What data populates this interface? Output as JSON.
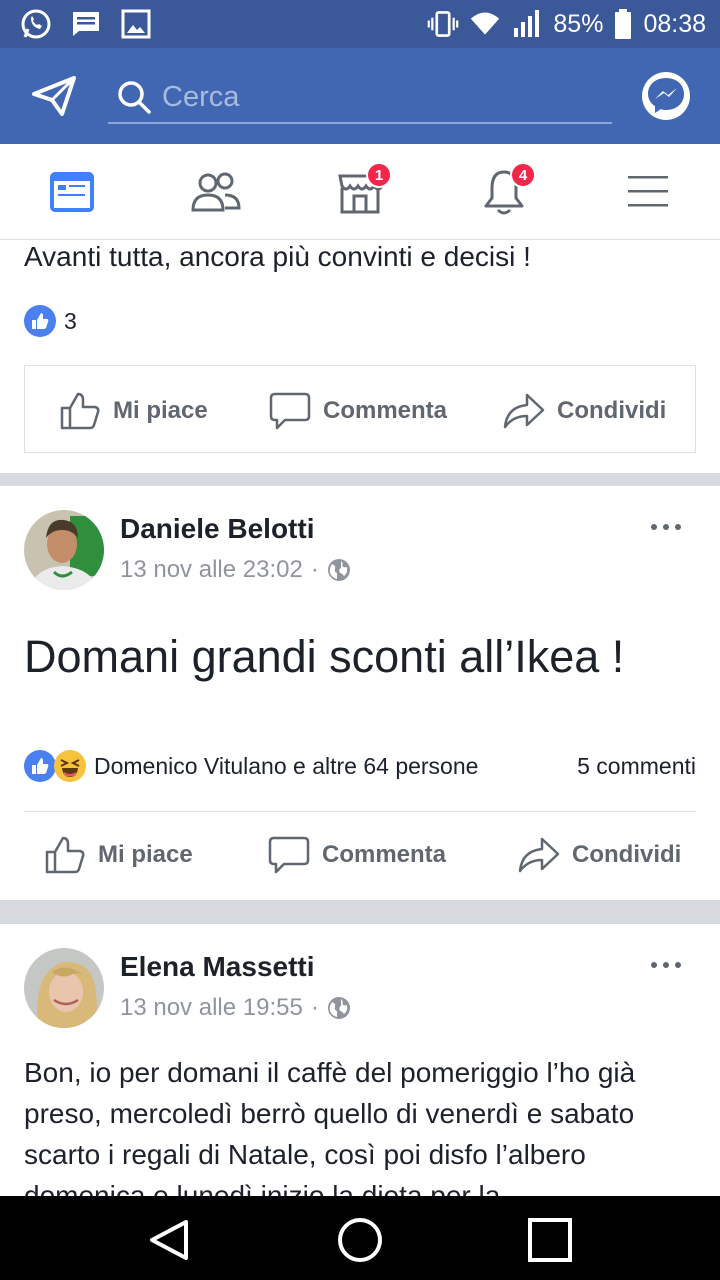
{
  "status_bar": {
    "battery_percent": "85%",
    "time": "08:38",
    "left_icons": [
      "whatsapp-icon",
      "message-icon",
      "image-icon"
    ],
    "right_icons": [
      "vibrate-icon",
      "wifi-icon",
      "signal-icon",
      "battery-icon"
    ]
  },
  "top_bar": {
    "search_placeholder": "Cerca",
    "left_icon": "send-icon",
    "right_icon": "messenger-icon"
  },
  "tabs": [
    {
      "name": "news-feed",
      "icon": "news-feed-icon",
      "active": true
    },
    {
      "name": "friends",
      "icon": "friends-icon"
    },
    {
      "name": "marketplace",
      "icon": "marketplace-icon",
      "badge": "1"
    },
    {
      "name": "notifications",
      "icon": "bell-icon",
      "badge": "4"
    },
    {
      "name": "menu",
      "icon": "menu-icon"
    }
  ],
  "colors": {
    "brand": "#3b5998",
    "bar": "#4267b2",
    "active_tab": "#4080ff",
    "badge": "#f02849"
  },
  "feed": {
    "post_prev": {
      "text": "Avanti tutta, ancora più convinti e decisi !",
      "like_count": "3",
      "actions": {
        "like": "Mi piace",
        "comment": "Commenta",
        "share": "Condividi"
      }
    },
    "post1": {
      "author": "Daniele Belotti",
      "time": "13 nov alle 23:02",
      "privacy_icon": "globe-icon",
      "text": "Domani grandi sconti all’Ikea !",
      "reactions": "Domenico Vitulano e altre 64 persone",
      "comments": "5 commenti",
      "actions": {
        "like": "Mi piace",
        "comment": "Commenta",
        "share": "Condividi"
      }
    },
    "post2": {
      "author": "Elena Massetti",
      "time": "13 nov alle 19:55",
      "privacy_icon": "globe-icon",
      "text": "Bon, io per domani il caffè del pomeriggio l’ho già preso, mercoledì berrò quello di venerdì e sabato scarto i regali di Natale, così poi disfo l’albero domenica e lunedì inizio la dieta per la"
    }
  },
  "nav_bar": [
    "back-icon",
    "home-icon",
    "recents-icon"
  ]
}
